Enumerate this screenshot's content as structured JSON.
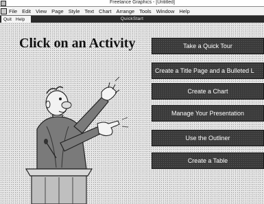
{
  "titlebar": {
    "app_title": "Freelance Graphics - [Untitled]"
  },
  "menu": {
    "items": [
      "File",
      "Edit",
      "View",
      "Page",
      "Style",
      "Text",
      "Chart",
      "Arrange",
      "Tools",
      "Window",
      "Help"
    ]
  },
  "submenu": {
    "items": [
      "Quit",
      "Help"
    ],
    "window_title": "QuickStart"
  },
  "main": {
    "heading": "Click on an Activity",
    "activities": [
      "Take a Quick Tour",
      "Create a Title Page and a Bulleted L",
      "Create a Chart",
      "Manage Your Presentation",
      "Use the Outliner",
      "Create a Table"
    ]
  },
  "colors": {
    "button_bg": "#3a3a3a",
    "button_text": "#ffffff",
    "background": "#e6e6e6"
  },
  "icons": {
    "presenter": "presenter-illustration"
  }
}
